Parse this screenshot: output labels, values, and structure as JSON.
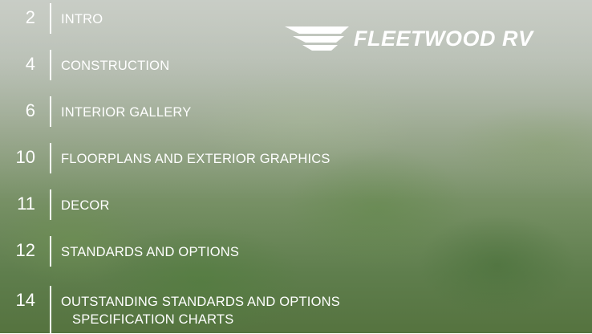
{
  "brand": {
    "logo_text": "FLEETWOOD RV",
    "logo_icon": "fleetwood-wings-icon"
  },
  "toc": [
    {
      "page": "2",
      "title": "INTRO"
    },
    {
      "page": "4",
      "title": "CONSTRUCTION"
    },
    {
      "page": "6",
      "title": "INTERIOR GALLERY"
    },
    {
      "page": "10",
      "title": "FLOORPLANS AND EXTERIOR GRAPHICS"
    },
    {
      "page": "11",
      "title": "DECOR"
    },
    {
      "page": "12",
      "title": "STANDARDS AND OPTIONS"
    },
    {
      "page": "14",
      "title": "OUTSTANDING STANDARDS AND OPTIONS",
      "title_line2": "SPECIFICATION CHARTS"
    }
  ],
  "colors": {
    "text": "#ffffff"
  }
}
